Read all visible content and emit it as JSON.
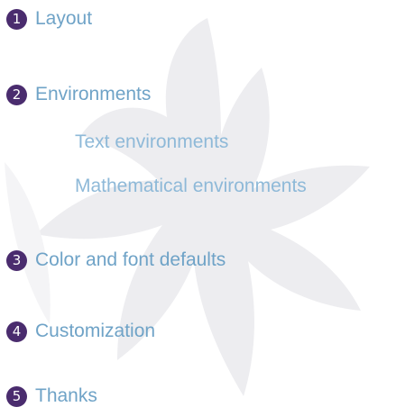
{
  "colors": {
    "badge": "#4a2c6e",
    "section_text": "#6fa3c7",
    "subsection_text": "#8eb9d8",
    "watermark": "#ededf0"
  },
  "watermark_icon": "leaf-watermark-icon",
  "toc": {
    "sections": [
      {
        "number": "1",
        "label": "Layout"
      },
      {
        "number": "2",
        "label": "Environments",
        "subsections": [
          "Text environments",
          "Mathematical environments"
        ]
      },
      {
        "number": "3",
        "label": "Color and font defaults"
      },
      {
        "number": "4",
        "label": "Customization"
      },
      {
        "number": "5",
        "label": "Thanks"
      }
    ]
  }
}
